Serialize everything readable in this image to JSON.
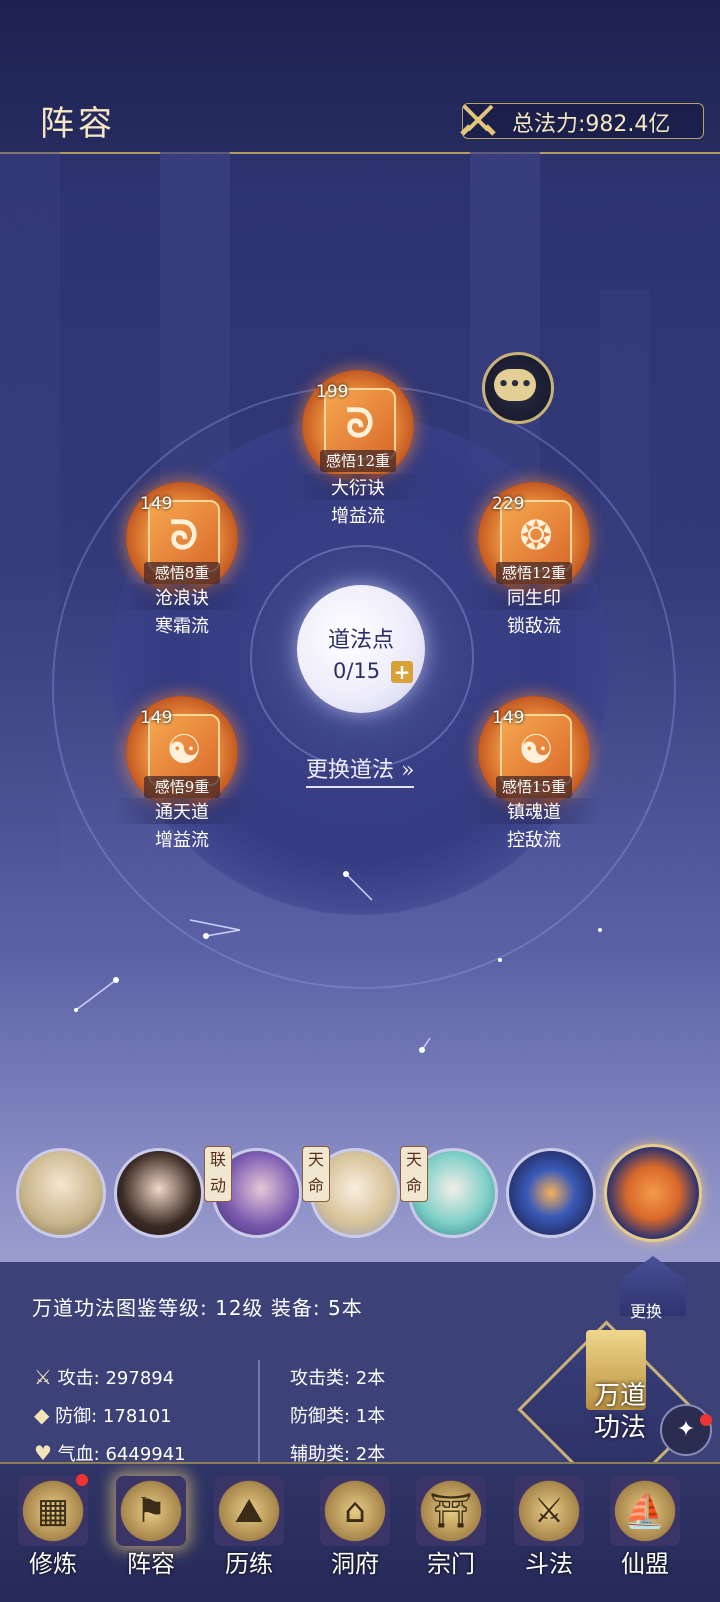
{
  "header": {
    "title": "阵容",
    "power_text": "总法力:982.4亿"
  },
  "core": {
    "title": "道法点",
    "value": "0/15",
    "plus": "+"
  },
  "switch_label": "更换道法",
  "nodes": [
    {
      "level": "199",
      "tag": "感悟12重",
      "name": "大衍诀",
      "sub": "增益流",
      "glyph": "ᘐ"
    },
    {
      "level": "149",
      "tag": "感悟8重",
      "name": "沧浪诀",
      "sub": "寒霜流",
      "glyph": "ᘐ"
    },
    {
      "level": "229",
      "tag": "感悟12重",
      "name": "同生印",
      "sub": "锁敌流",
      "glyph": "❂"
    },
    {
      "level": "149",
      "tag": "感悟9重",
      "name": "通天道",
      "sub": "增益流",
      "glyph": "☯"
    },
    {
      "level": "149",
      "tag": "感悟15重",
      "name": "镇魂道",
      "sub": "控敌流",
      "glyph": "☯"
    }
  ],
  "roster": {
    "badges": [
      "联动",
      "天命",
      "天命"
    ]
  },
  "panel": {
    "title": "万道功法图鉴等级: 12级  装备: 5本",
    "stats": [
      {
        "icon": "sword-icon",
        "label": "攻击: 297894"
      },
      {
        "icon": "shield-icon",
        "label": "防御: 178101"
      },
      {
        "icon": "heart-icon",
        "label": "气血: 6449941"
      }
    ],
    "types": [
      {
        "label": "攻击类: 2本"
      },
      {
        "label": "防御类: 1本"
      },
      {
        "label": "辅助类: 2本"
      }
    ],
    "swap_label": "更换",
    "wandao_label_1": "万道",
    "wandao_label_2": "功法"
  },
  "nav": [
    {
      "label": "修炼",
      "icon": "cultivate-icon",
      "glyph": "▦"
    },
    {
      "label": "阵容",
      "icon": "formation-icon",
      "glyph": "⚑"
    },
    {
      "label": "历练",
      "icon": "trial-icon",
      "glyph": "⛰"
    },
    {
      "label": "洞府",
      "icon": "cave-icon",
      "glyph": "⌂"
    },
    {
      "label": "宗门",
      "icon": "sect-icon",
      "glyph": "⛩"
    },
    {
      "label": "斗法",
      "icon": "duel-icon",
      "glyph": "⚔"
    },
    {
      "label": "仙盟",
      "icon": "alliance-icon",
      "glyph": "⛵"
    }
  ]
}
